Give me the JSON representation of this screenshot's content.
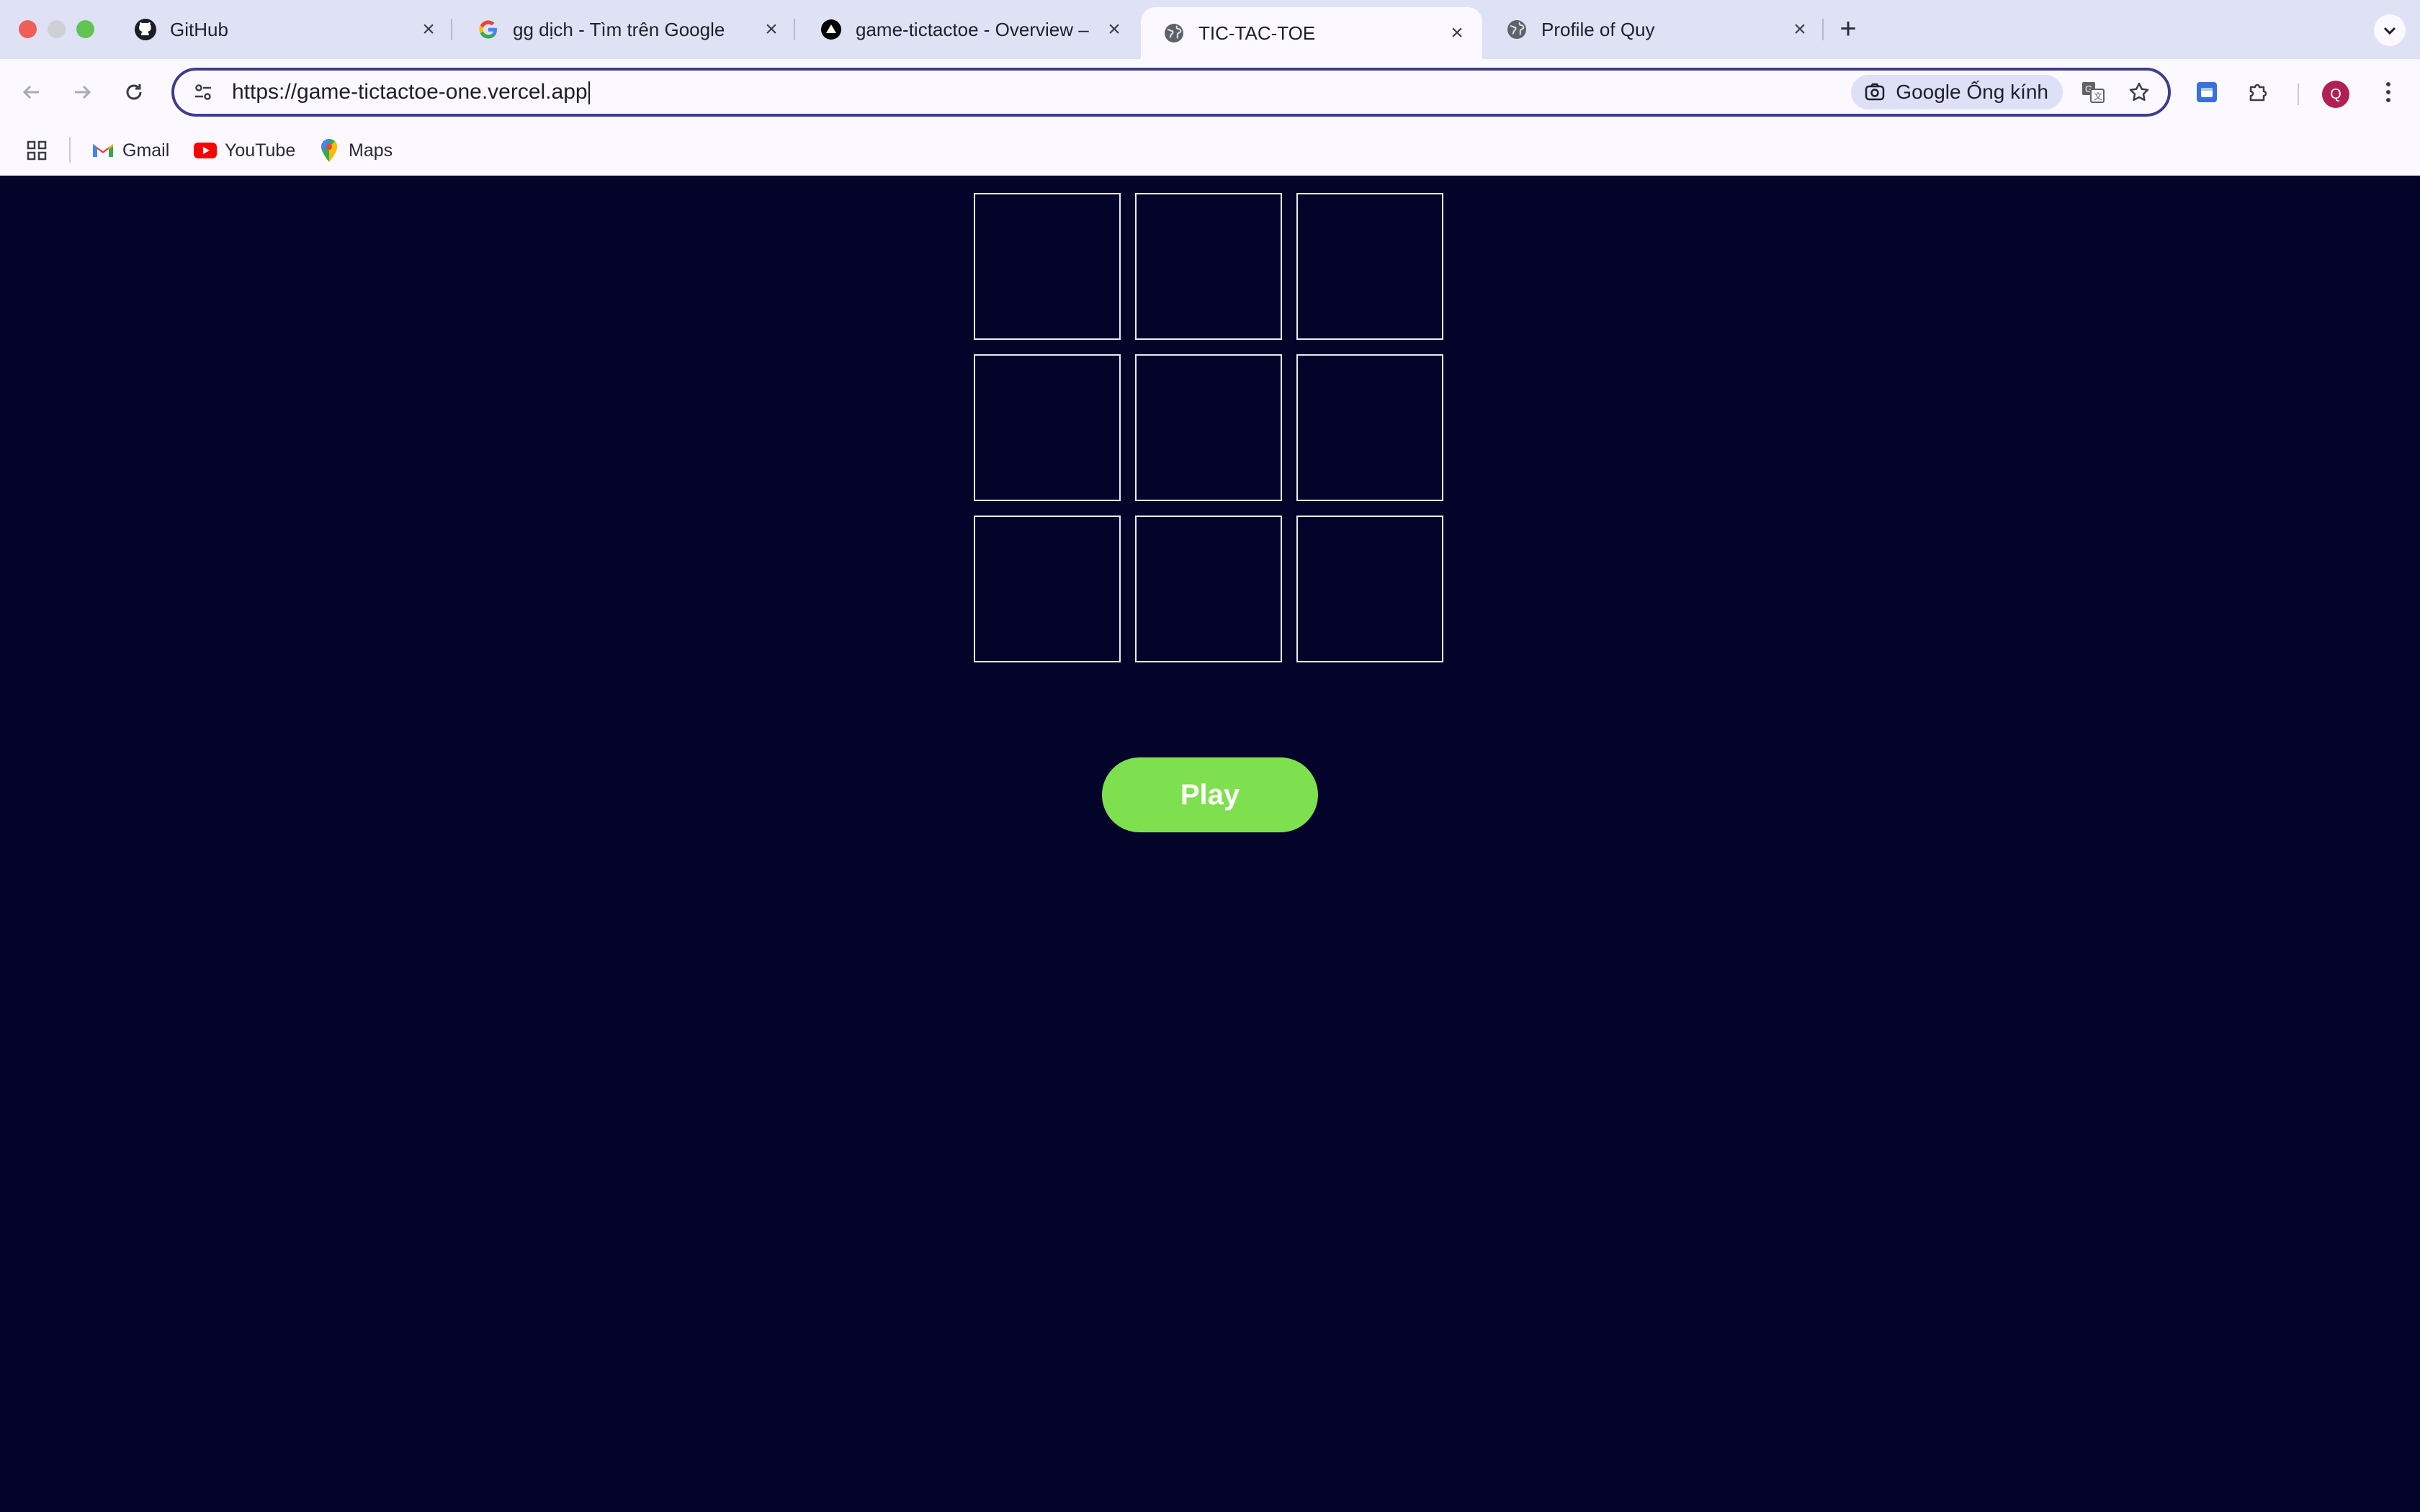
{
  "browser": {
    "tabs": [
      {
        "title": "GitHub",
        "favicon": "github-icon",
        "active": false
      },
      {
        "title": "gg dịch - Tìm trên Google",
        "favicon": "google-icon",
        "active": false
      },
      {
        "title": "game-tictactoe - Overview –",
        "favicon": "vercel-icon",
        "active": false
      },
      {
        "title": "TIC-TAC-TOE",
        "favicon": "globe-icon",
        "active": true
      },
      {
        "title": "Profile of Quy",
        "favicon": "globe-icon",
        "active": false
      }
    ],
    "url": "https://game-tictactoe-one.vercel.app",
    "lens_label": "Google Ống kính",
    "profile_initial": "Q",
    "bookmarks": [
      {
        "label": "Gmail",
        "icon": "gmail-icon"
      },
      {
        "label": "YouTube",
        "icon": "youtube-icon"
      },
      {
        "label": "Maps",
        "icon": "maps-icon"
      }
    ]
  },
  "game": {
    "board": [
      "",
      "",
      "",
      "",
      "",
      "",
      "",
      "",
      ""
    ],
    "play_label": "Play"
  },
  "colors": {
    "page_background": "#04042a",
    "cell_border": "#e9e9f2",
    "play_button": "#7ee04f",
    "omnibox_focus": "#3f3d8e",
    "avatar": "#b1214f"
  }
}
